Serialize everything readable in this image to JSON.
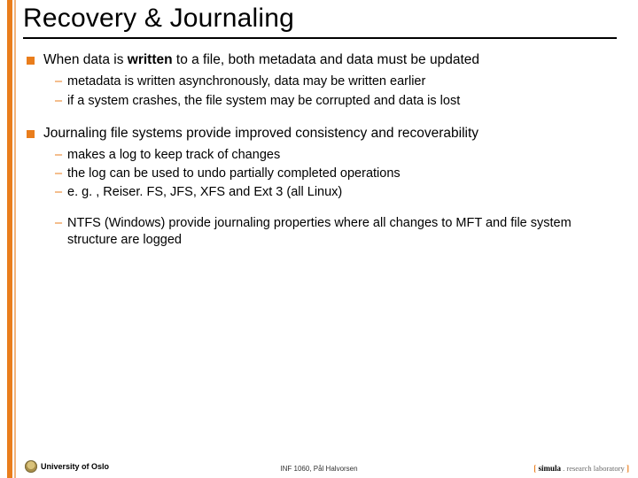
{
  "title": "Recovery & Journaling",
  "bullets": [
    {
      "pre": "When data is ",
      "bold": "written",
      "post": " to a file, both metadata and data must be updated",
      "subs": [
        "metadata is written asynchronously, data may be written earlier",
        "if a system crashes, the file system may be corrupted and data is lost"
      ]
    },
    {
      "pre": "Journaling file systems provide improved consistency and recoverability",
      "bold": "",
      "post": "",
      "subs": [
        "makes a log to keep track of changes",
        "the log can be used to undo partially completed operations",
        "e. g. , Reiser. FS, JFS, XFS and Ext 3 (all Linux)",
        "",
        "NTFS (Windows) provide journaling properties where all changes to MFT and file system structure are logged"
      ]
    }
  ],
  "footer": {
    "left": "University of Oslo",
    "center": "INF 1060, Pål Halvorsen",
    "right_bracket_l": "[ ",
    "right_name": "simula",
    "right_dot": " . ",
    "right_lab": "research laboratory",
    "right_bracket_r": " ]"
  }
}
